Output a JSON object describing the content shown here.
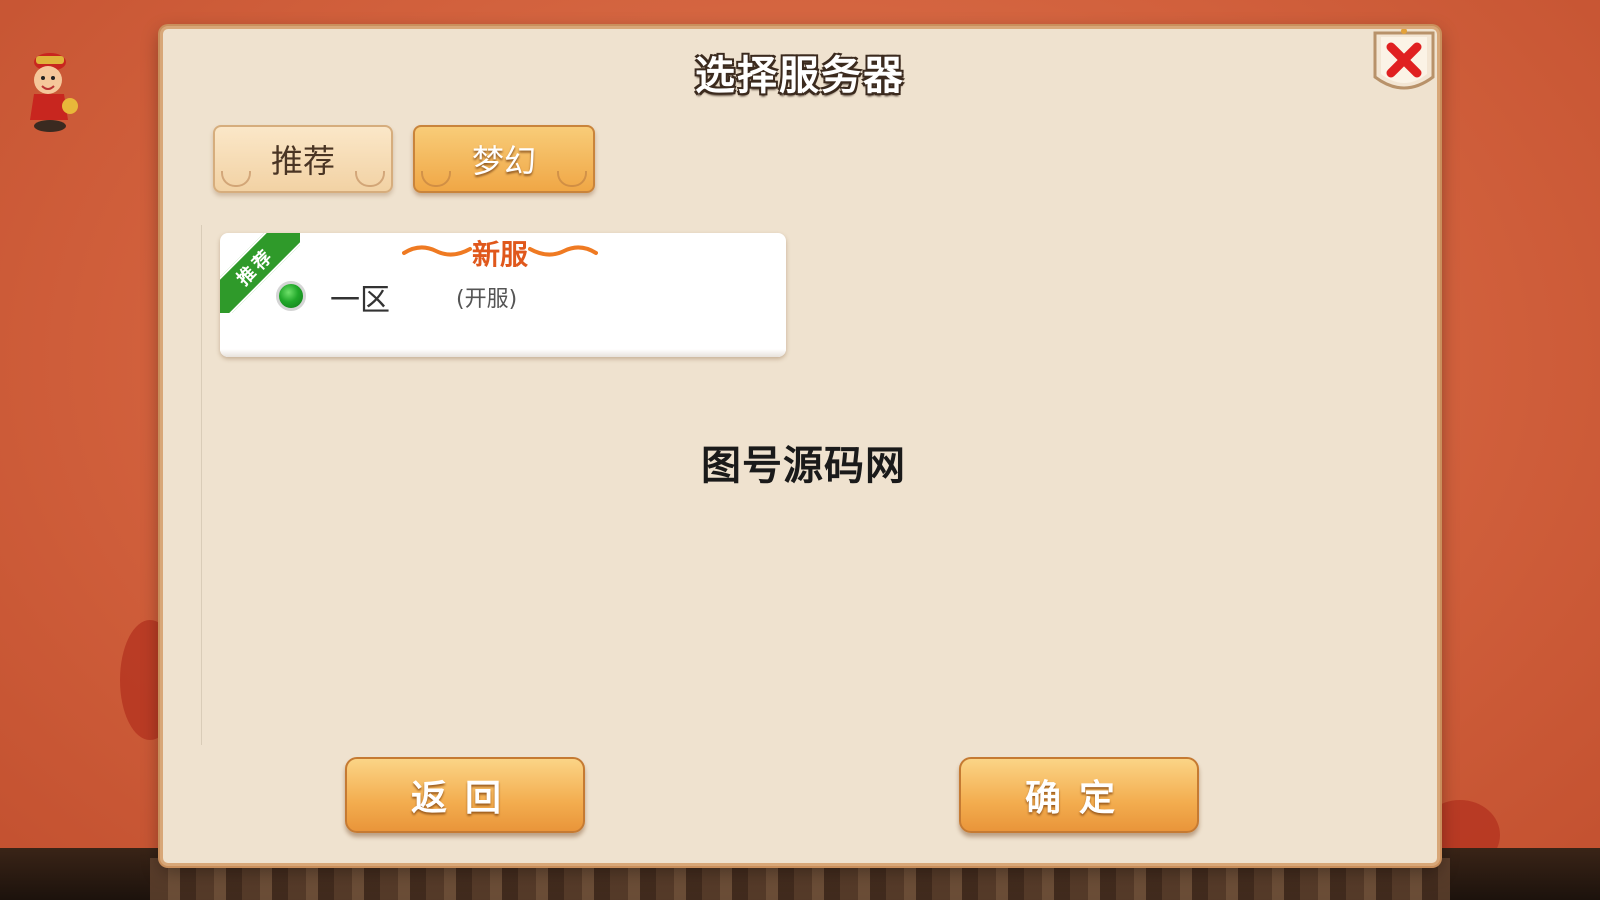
{
  "dialog": {
    "title": "选择服务器"
  },
  "tabs": [
    {
      "label": "推荐",
      "active": false
    },
    {
      "label": "梦幻",
      "active": true
    }
  ],
  "server_list": [
    {
      "badge": "推荐",
      "tag": "新服",
      "name": "一区",
      "status": "(开服)",
      "selected": true
    }
  ],
  "watermark": "图号源码网",
  "buttons": {
    "back_label": "返回",
    "confirm_label": "确定"
  },
  "icons": {
    "close": "close-icon",
    "mascot": "mascot-icon",
    "radio": "radio-selected-icon"
  },
  "colors": {
    "panel": "#efe2cf",
    "accent_orange": "#f3ad4f",
    "ribbon_green": "#2f9a2a",
    "close_red": "#e02020",
    "new_tag": "#e0581c"
  }
}
